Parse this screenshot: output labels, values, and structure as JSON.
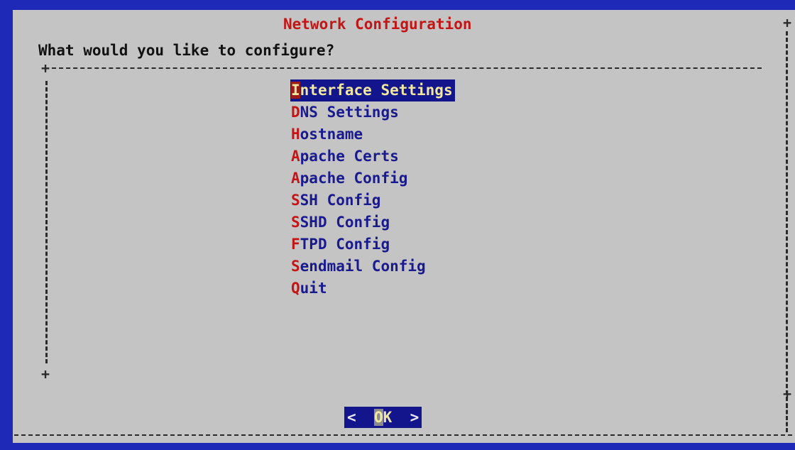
{
  "dialog": {
    "title": "Network Configuration",
    "prompt": "What would you like to configure?",
    "colors": {
      "screen_background": "#1e29b8",
      "dialog_background": "#c4c4c4",
      "title": "#c21515",
      "item_text": "#1a1a8f",
      "hotkey": "#c21515",
      "selection_background": "#13158c",
      "selection_text": "#f0e7a0"
    }
  },
  "menu": {
    "selected_index": 0,
    "items": [
      {
        "hotkey": "I",
        "rest": "nterface Settings"
      },
      {
        "hotkey": "D",
        "rest": "NS Settings"
      },
      {
        "hotkey": "H",
        "rest": "ostname"
      },
      {
        "hotkey": "A",
        "rest": "pache Certs"
      },
      {
        "hotkey": "A",
        "rest": "pache Config"
      },
      {
        "hotkey": "S",
        "rest": "SH Config"
      },
      {
        "hotkey": "S",
        "rest": "SHD Config"
      },
      {
        "hotkey": "F",
        "rest": "TPD Config"
      },
      {
        "hotkey": "S",
        "rest": "endmail Config"
      },
      {
        "hotkey": "Q",
        "rest": "uit"
      }
    ]
  },
  "buttons": {
    "ok": {
      "left_bracket": "<",
      "hotkey": "O",
      "rest": "K",
      "right_bracket": ">"
    }
  },
  "frame": {
    "plus": "+"
  }
}
